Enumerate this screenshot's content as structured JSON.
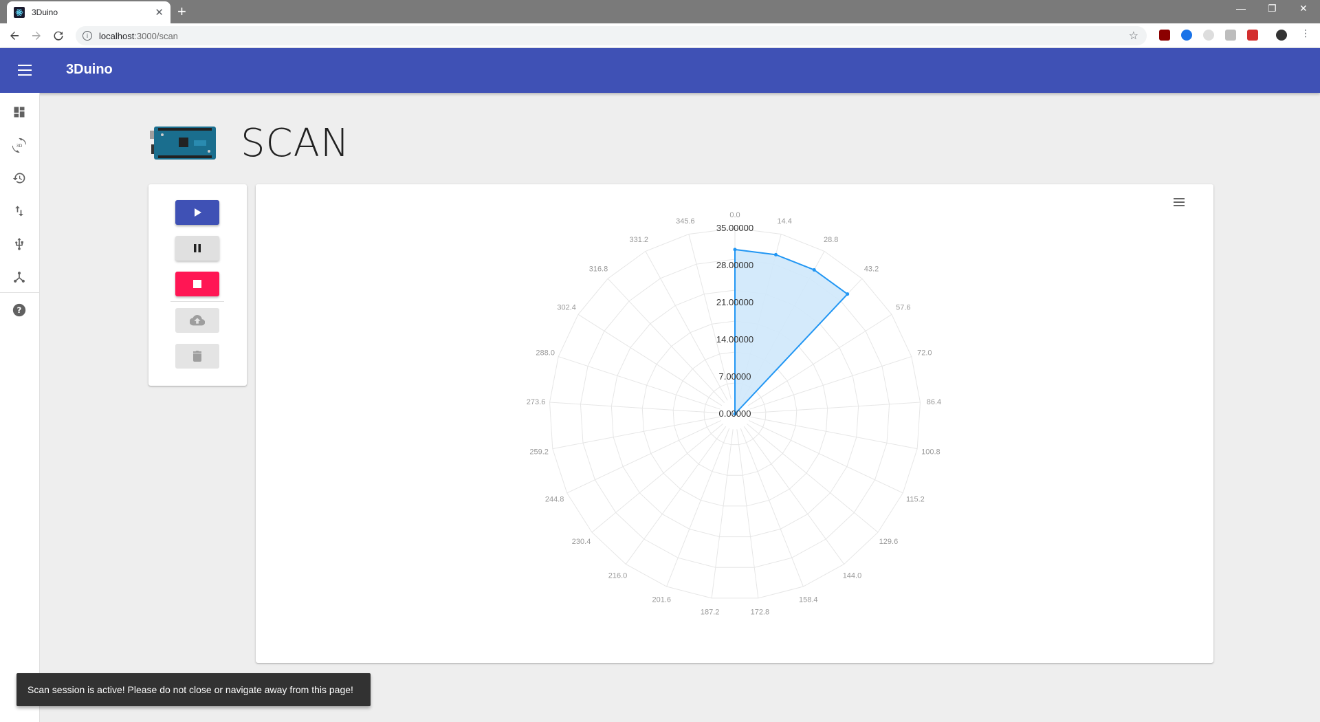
{
  "browser": {
    "tab_title": "3Duino",
    "tab_close": "✕",
    "new_tab": "+",
    "url_host": "localhost",
    "url_path": ":3000/scan",
    "window_minimize": "—",
    "window_restore": "❐",
    "window_close": "✕"
  },
  "app": {
    "title": "3Duino"
  },
  "sidenav": {
    "items": [
      {
        "icon": "dashboard-icon"
      },
      {
        "icon": "3d-rotation-icon"
      },
      {
        "icon": "history-icon"
      },
      {
        "icon": "import-export-icon"
      },
      {
        "icon": "usb-icon"
      },
      {
        "icon": "network-icon"
      },
      {
        "icon": "help-icon"
      }
    ]
  },
  "page": {
    "title": "SCAN"
  },
  "controls": {
    "play": "play-icon",
    "pause": "pause-icon",
    "stop": "stop-icon",
    "upload": "cloud-upload-icon",
    "delete": "delete-icon"
  },
  "chart_data": {
    "type": "polar-area",
    "angle_labels": [
      "0.0",
      "14.4",
      "28.8",
      "43.2",
      "57.6",
      "72.0",
      "86.4",
      "100.8",
      "115.2",
      "129.6",
      "144.0",
      "158.4",
      "172.8",
      "187.2",
      "201.6",
      "216.0",
      "230.4",
      "244.8",
      "259.2",
      "273.6",
      "288.0",
      "302.4",
      "316.8",
      "331.2",
      "345.6"
    ],
    "radial_ticks": [
      "0.00000",
      "7.00000",
      "14.00000",
      "21.00000",
      "28.00000",
      "35.00000"
    ],
    "rmax": 35,
    "points": [
      {
        "angle": 0.0,
        "r": 31
      },
      {
        "angle": 14.4,
        "r": 31
      },
      {
        "angle": 28.8,
        "r": 31
      },
      {
        "angle": 43.2,
        "r": 31
      }
    ],
    "color": "#2196f3",
    "fill": "#cfe8fb"
  },
  "snackbar": {
    "message": "Scan session is active! Please do not close or navigate away from this page!"
  }
}
